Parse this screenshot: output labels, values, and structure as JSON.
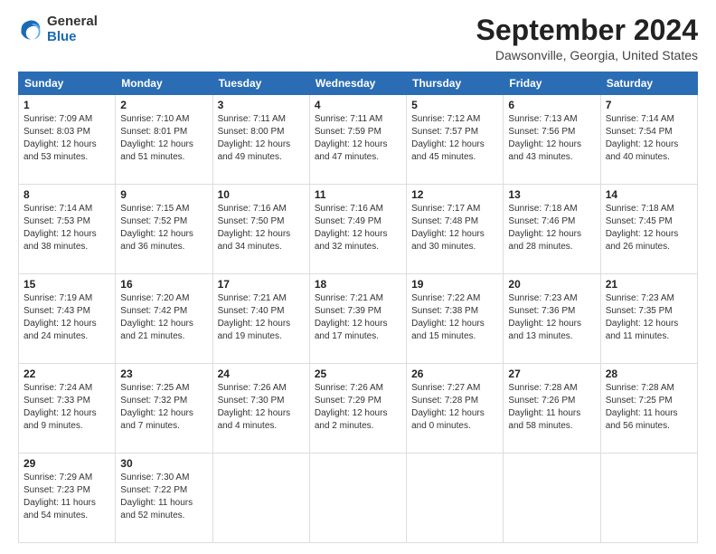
{
  "header": {
    "logo_line1": "General",
    "logo_line2": "Blue",
    "month_title": "September 2024",
    "location": "Dawsonville, Georgia, United States"
  },
  "weekdays": [
    "Sunday",
    "Monday",
    "Tuesday",
    "Wednesday",
    "Thursday",
    "Friday",
    "Saturday"
  ],
  "weeks": [
    [
      {
        "day": 1,
        "sunrise": "7:09 AM",
        "sunset": "8:03 PM",
        "daylight": "12 hours and 53 minutes."
      },
      {
        "day": 2,
        "sunrise": "7:10 AM",
        "sunset": "8:01 PM",
        "daylight": "12 hours and 51 minutes."
      },
      {
        "day": 3,
        "sunrise": "7:11 AM",
        "sunset": "8:00 PM",
        "daylight": "12 hours and 49 minutes."
      },
      {
        "day": 4,
        "sunrise": "7:11 AM",
        "sunset": "7:59 PM",
        "daylight": "12 hours and 47 minutes."
      },
      {
        "day": 5,
        "sunrise": "7:12 AM",
        "sunset": "7:57 PM",
        "daylight": "12 hours and 45 minutes."
      },
      {
        "day": 6,
        "sunrise": "7:13 AM",
        "sunset": "7:56 PM",
        "daylight": "12 hours and 43 minutes."
      },
      {
        "day": 7,
        "sunrise": "7:14 AM",
        "sunset": "7:54 PM",
        "daylight": "12 hours and 40 minutes."
      }
    ],
    [
      {
        "day": 8,
        "sunrise": "7:14 AM",
        "sunset": "7:53 PM",
        "daylight": "12 hours and 38 minutes."
      },
      {
        "day": 9,
        "sunrise": "7:15 AM",
        "sunset": "7:52 PM",
        "daylight": "12 hours and 36 minutes."
      },
      {
        "day": 10,
        "sunrise": "7:16 AM",
        "sunset": "7:50 PM",
        "daylight": "12 hours and 34 minutes."
      },
      {
        "day": 11,
        "sunrise": "7:16 AM",
        "sunset": "7:49 PM",
        "daylight": "12 hours and 32 minutes."
      },
      {
        "day": 12,
        "sunrise": "7:17 AM",
        "sunset": "7:48 PM",
        "daylight": "12 hours and 30 minutes."
      },
      {
        "day": 13,
        "sunrise": "7:18 AM",
        "sunset": "7:46 PM",
        "daylight": "12 hours and 28 minutes."
      },
      {
        "day": 14,
        "sunrise": "7:18 AM",
        "sunset": "7:45 PM",
        "daylight": "12 hours and 26 minutes."
      }
    ],
    [
      {
        "day": 15,
        "sunrise": "7:19 AM",
        "sunset": "7:43 PM",
        "daylight": "12 hours and 24 minutes."
      },
      {
        "day": 16,
        "sunrise": "7:20 AM",
        "sunset": "7:42 PM",
        "daylight": "12 hours and 21 minutes."
      },
      {
        "day": 17,
        "sunrise": "7:21 AM",
        "sunset": "7:40 PM",
        "daylight": "12 hours and 19 minutes."
      },
      {
        "day": 18,
        "sunrise": "7:21 AM",
        "sunset": "7:39 PM",
        "daylight": "12 hours and 17 minutes."
      },
      {
        "day": 19,
        "sunrise": "7:22 AM",
        "sunset": "7:38 PM",
        "daylight": "12 hours and 15 minutes."
      },
      {
        "day": 20,
        "sunrise": "7:23 AM",
        "sunset": "7:36 PM",
        "daylight": "12 hours and 13 minutes."
      },
      {
        "day": 21,
        "sunrise": "7:23 AM",
        "sunset": "7:35 PM",
        "daylight": "12 hours and 11 minutes."
      }
    ],
    [
      {
        "day": 22,
        "sunrise": "7:24 AM",
        "sunset": "7:33 PM",
        "daylight": "12 hours and 9 minutes."
      },
      {
        "day": 23,
        "sunrise": "7:25 AM",
        "sunset": "7:32 PM",
        "daylight": "12 hours and 7 minutes."
      },
      {
        "day": 24,
        "sunrise": "7:26 AM",
        "sunset": "7:30 PM",
        "daylight": "12 hours and 4 minutes."
      },
      {
        "day": 25,
        "sunrise": "7:26 AM",
        "sunset": "7:29 PM",
        "daylight": "12 hours and 2 minutes."
      },
      {
        "day": 26,
        "sunrise": "7:27 AM",
        "sunset": "7:28 PM",
        "daylight": "12 hours and 0 minutes."
      },
      {
        "day": 27,
        "sunrise": "7:28 AM",
        "sunset": "7:26 PM",
        "daylight": "11 hours and 58 minutes."
      },
      {
        "day": 28,
        "sunrise": "7:28 AM",
        "sunset": "7:25 PM",
        "daylight": "11 hours and 56 minutes."
      }
    ],
    [
      {
        "day": 29,
        "sunrise": "7:29 AM",
        "sunset": "7:23 PM",
        "daylight": "11 hours and 54 minutes."
      },
      {
        "day": 30,
        "sunrise": "7:30 AM",
        "sunset": "7:22 PM",
        "daylight": "11 hours and 52 minutes."
      },
      null,
      null,
      null,
      null,
      null
    ]
  ]
}
